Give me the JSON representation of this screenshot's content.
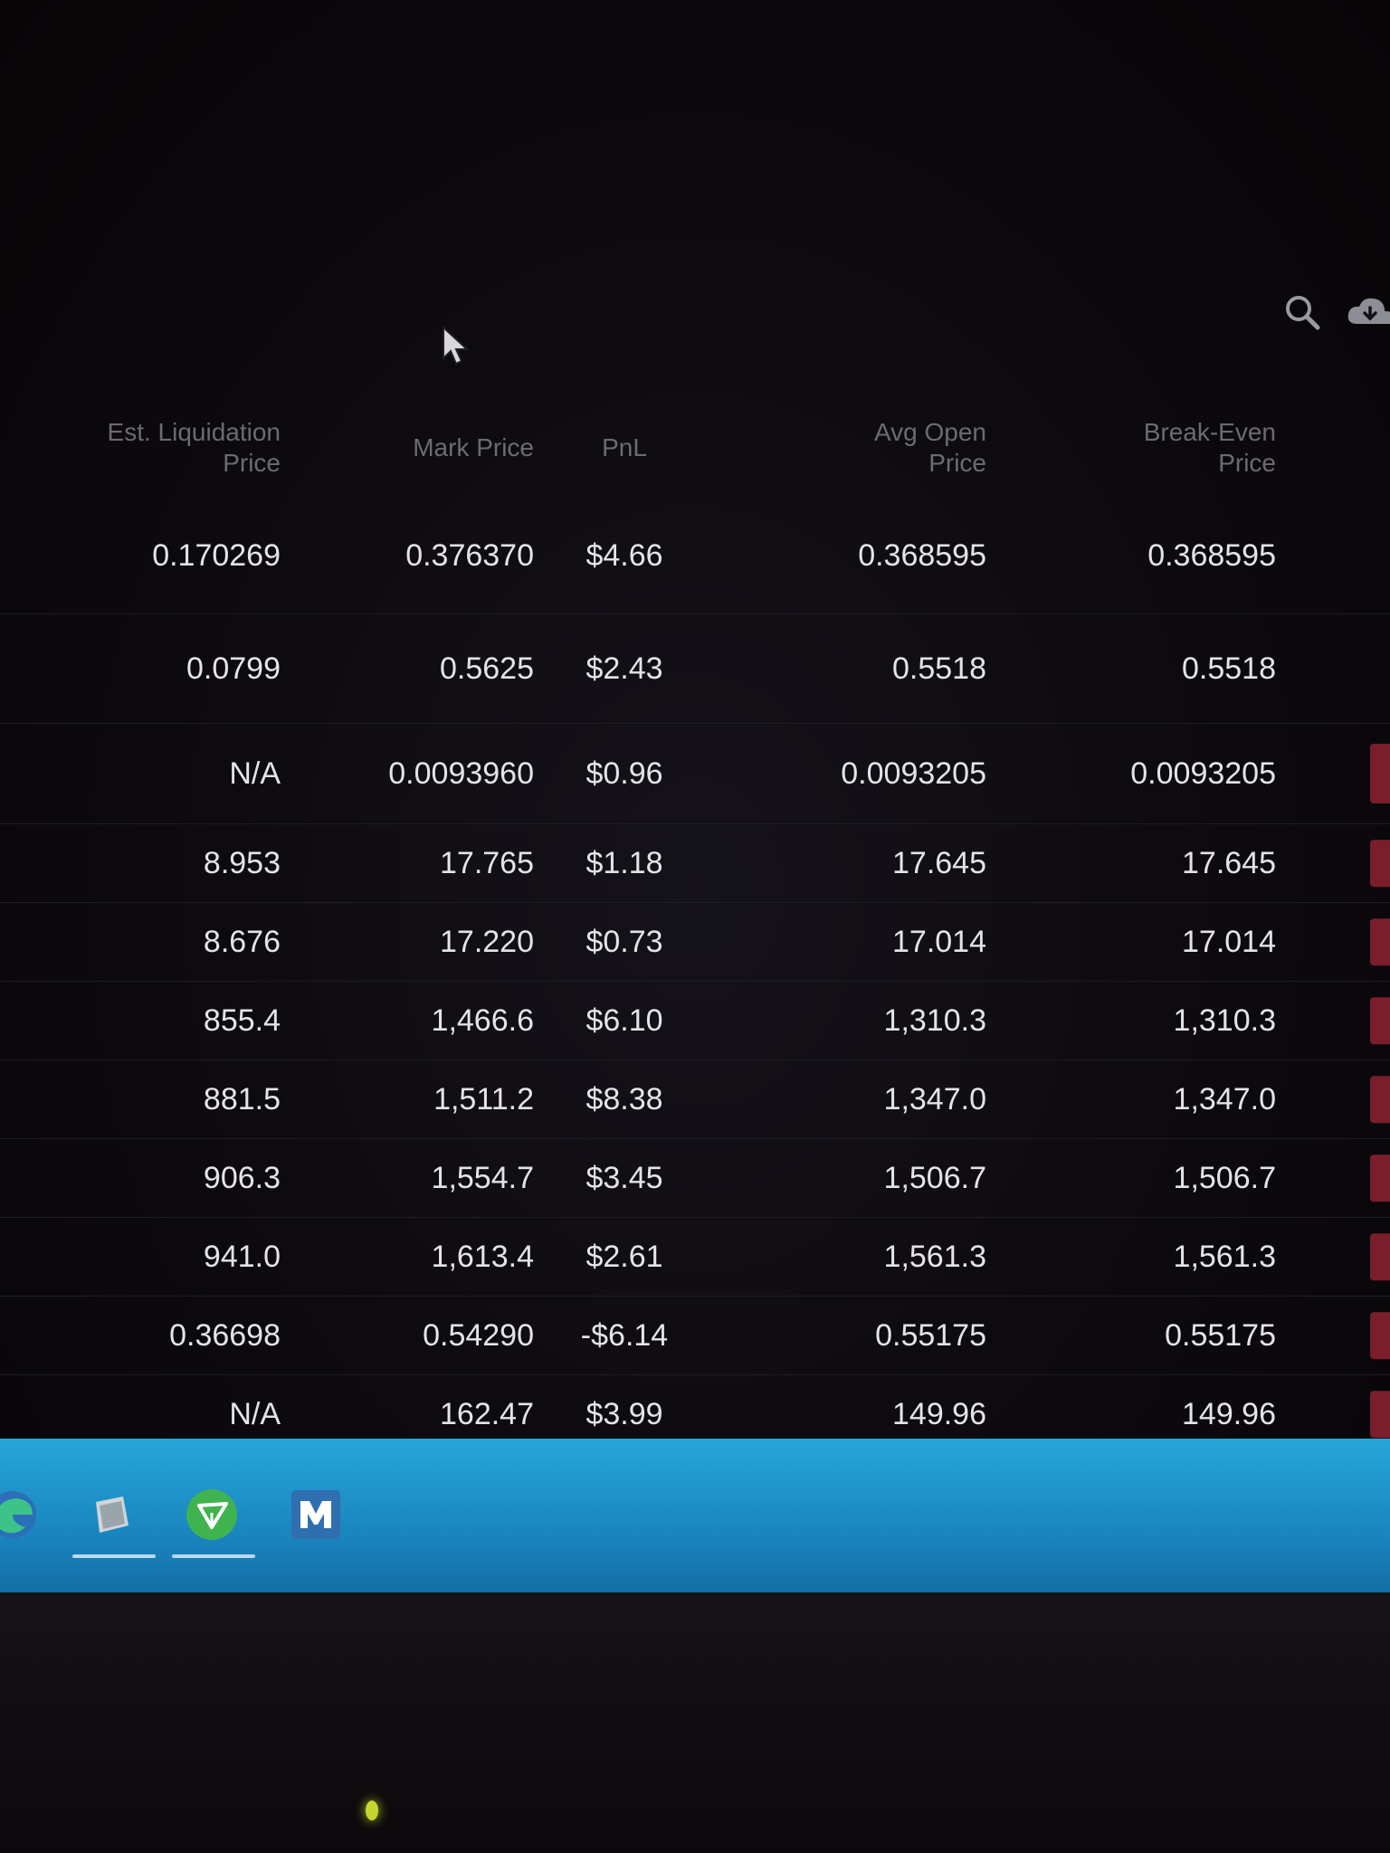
{
  "table": {
    "columns": [
      {
        "label": "Est. Liquidation Price"
      },
      {
        "label": "Mark Price"
      },
      {
        "label": "PnL"
      },
      {
        "label": "Avg Open Price"
      },
      {
        "label": "Break-Even Price"
      }
    ],
    "rows": [
      {
        "liq": "0.170269",
        "mark": "0.376370",
        "pnl": "$4.66",
        "avg_open": "0.368595",
        "break_even": "0.368595"
      },
      {
        "liq": "0.0799",
        "mark": "0.5625",
        "pnl": "$2.43",
        "avg_open": "0.5518",
        "break_even": "0.5518"
      },
      {
        "liq": "N/A",
        "mark": "0.0093960",
        "pnl": "$0.96",
        "avg_open": "0.0093205",
        "break_even": "0.0093205"
      },
      {
        "liq": "8.953",
        "mark": "17.765",
        "pnl": "$1.18",
        "avg_open": "17.645",
        "break_even": "17.645"
      },
      {
        "liq": "8.676",
        "mark": "17.220",
        "pnl": "$0.73",
        "avg_open": "17.014",
        "break_even": "17.014"
      },
      {
        "liq": "855.4",
        "mark": "1,466.6",
        "pnl": "$6.10",
        "avg_open": "1,310.3",
        "break_even": "1,310.3"
      },
      {
        "liq": "881.5",
        "mark": "1,511.2",
        "pnl": "$8.38",
        "avg_open": "1,347.0",
        "break_even": "1,347.0"
      },
      {
        "liq": "906.3",
        "mark": "1,554.7",
        "pnl": "$3.45",
        "avg_open": "1,506.7",
        "break_even": "1,506.7"
      },
      {
        "liq": "941.0",
        "mark": "1,613.4",
        "pnl": "$2.61",
        "avg_open": "1,561.3",
        "break_even": "1,561.3"
      },
      {
        "liq": "0.36698",
        "mark": "0.54290",
        "pnl": "-$6.14",
        "avg_open": "0.55175",
        "break_even": "0.55175"
      },
      {
        "liq": "N/A",
        "mark": "162.47",
        "pnl": "$3.99",
        "avg_open": "149.96",
        "break_even": "149.96"
      }
    ]
  },
  "toolbar": {
    "search_icon": "search-icon",
    "cloud_icon": "cloud-icon"
  },
  "taskbar": {
    "apps": [
      "edge-browser-icon",
      "file-app-icon",
      "send-app-icon",
      "m-app-icon"
    ]
  },
  "colors": {
    "positive": "#37b45e",
    "negative": "#e0404a",
    "taskbar": "#1f95cd",
    "row_action": "#7a1e2c"
  }
}
